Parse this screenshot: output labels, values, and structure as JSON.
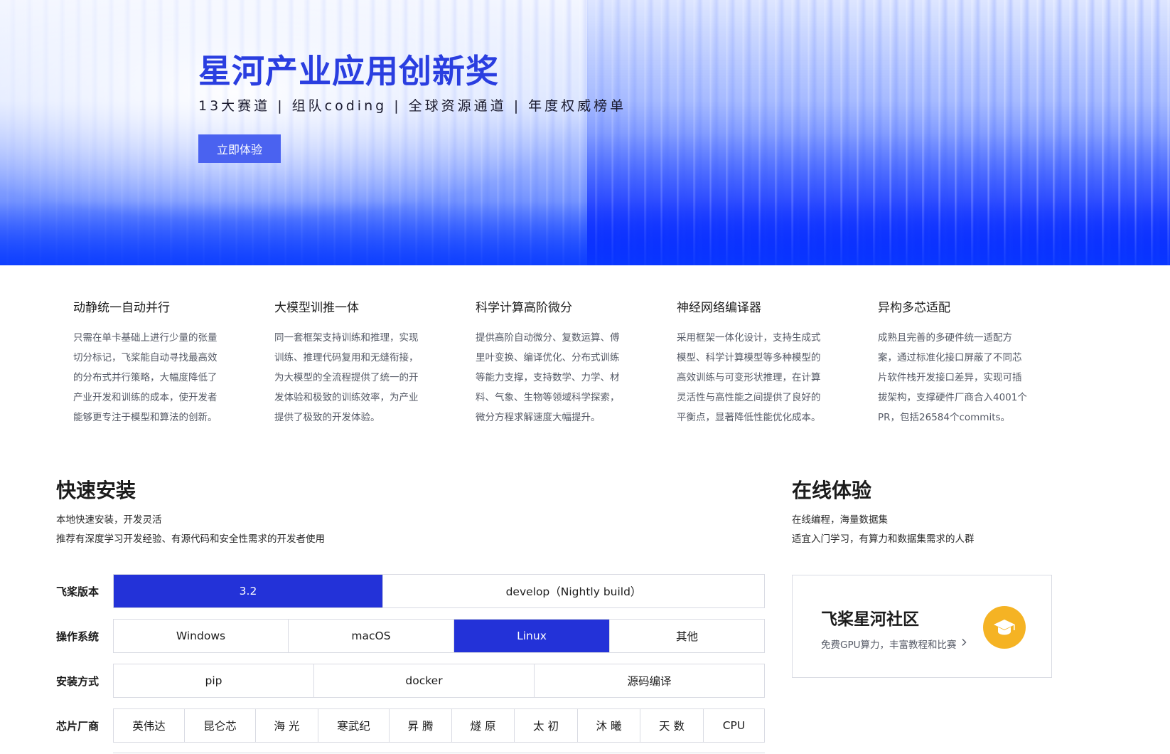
{
  "hero": {
    "title": "星河产业应用创新奖",
    "subtitle": "13大赛道 | 组队coding | 全球资源通道 | 年度权威榜单",
    "cta_label": "立即体验"
  },
  "features": [
    {
      "title": "动静统一自动并行",
      "lines": [
        "只需在单卡基础上进行少量的张量",
        "切分标记，飞桨能自动寻找最高效",
        "的分布式并行策略，大幅度降低了",
        "产业开发和训练的成本，使开发者",
        "能够更专注于模型和算法的创新。"
      ]
    },
    {
      "title": "大模型训推一体",
      "lines": [
        "同一套框架支持训练和推理，实现",
        "训练、推理代码复用和无缝衔接，",
        "为大模型的全流程提供了统一的开",
        "发体验和极致的训练效率，为产业",
        "提供了极致的开发体验。"
      ]
    },
    {
      "title": "科学计算高阶微分",
      "lines": [
        "提供高阶自动微分、复数运算、傅",
        "里叶变换、编译优化、分布式训练",
        "等能力支撑，支持数学、力学、材",
        "料、气象、生物等领域科学探索，",
        "微分方程求解速度大幅提升。"
      ]
    },
    {
      "title": "神经网络编译器",
      "lines": [
        "采用框架一体化设计，支持生成式",
        "模型、科学计算模型等多种模型的",
        "高效训练与可变形状推理，在计算",
        "灵活性与高性能之间提供了良好的",
        "平衡点，显著降低性能优化成本。"
      ]
    },
    {
      "title": "异构多芯适配",
      "lines": [
        "成熟且完善的多硬件统一适配方",
        "案，通过标准化接口屏蔽了不同芯",
        "片软件栈开发接口差异，实现可插",
        "拔架构，支撑硬件厂商合入4001个",
        "PR，包括26584个commits。"
      ]
    }
  ],
  "quick_install": {
    "title": "快速安装",
    "line1": "本地快速安装，开发灵活",
    "line2": "推荐有深度学习开发经验、有源代码和安全性需求的开发者使用",
    "rows": {
      "version": {
        "label": "飞桨版本",
        "options": [
          "3.2",
          "develop（Nightly build）"
        ],
        "selected": "3.2"
      },
      "os": {
        "label": "操作系统",
        "options": [
          "Windows",
          "macOS",
          "Linux",
          "其他"
        ],
        "selected": "Linux"
      },
      "method": {
        "label": "安装方式",
        "options": [
          "pip",
          "docker",
          "源码编译"
        ]
      },
      "chip": {
        "label": "芯片厂商",
        "options": [
          "英伟达",
          "昆仑芯",
          "海 光",
          "寒武纪",
          "昇 腾",
          "燧 原",
          "太 初",
          "沐 曦",
          "天 数",
          "CPU"
        ]
      }
    }
  },
  "online": {
    "title": "在线体验",
    "line1": "在线编程，海量数据集",
    "line2": "适宜入门学习，有算力和数据集需求的人群",
    "card": {
      "title": "飞桨星河社区",
      "subtitle": "免费GPU算力，丰富教程和比赛",
      "icon": "graduation-cap-icon",
      "icon_color": "#f5b324"
    }
  },
  "colors": {
    "accent": "#2332d8",
    "cta": "#4a62f0",
    "title_blue": "#2a3ee0"
  }
}
